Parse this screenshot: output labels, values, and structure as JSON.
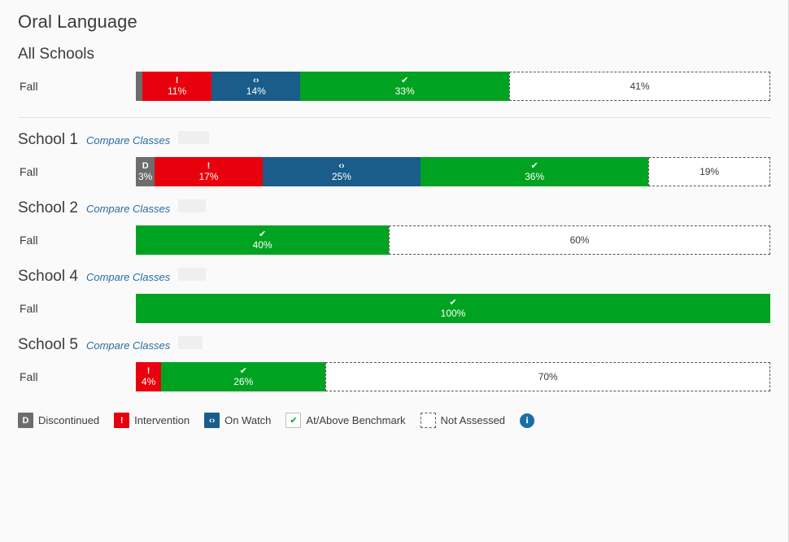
{
  "header": {
    "title": "Oral Language"
  },
  "compare_label": "Compare Classes",
  "row_label": "Fall",
  "legend": {
    "items": [
      {
        "key": "discontinued",
        "glyph": "D",
        "label": "Discontinued",
        "color": "#6d6d6d"
      },
      {
        "key": "intervention",
        "glyph": "!",
        "label": "Intervention",
        "color": "#e8000d"
      },
      {
        "key": "onwatch",
        "glyph": "‹›",
        "label": "On Watch",
        "color": "#1a5c8a"
      },
      {
        "key": "benchmark",
        "glyph": "✔",
        "label": "At/Above Benchmark",
        "color": "#00a321"
      },
      {
        "key": "notassessed",
        "glyph": "",
        "label": "Not Assessed",
        "color": "#ffffff"
      }
    ],
    "info_icon": "info-icon"
  },
  "chart_data": {
    "type": "bar",
    "title": "Oral Language",
    "orientation": "horizontal",
    "stacked": true,
    "unit": "percent",
    "xlim": [
      0,
      100
    ],
    "grid": false,
    "legend_position": "bottom",
    "series": [
      {
        "name": "Discontinued",
        "color": "#6d6d6d"
      },
      {
        "name": "Intervention",
        "color": "#e8000d"
      },
      {
        "name": "On Watch",
        "color": "#1a5c8a"
      },
      {
        "name": "At/Above Benchmark",
        "color": "#00a321"
      },
      {
        "name": "Not Assessed",
        "color": "#ffffff"
      }
    ],
    "groups": [
      {
        "name": "All Schools",
        "has_compare": false,
        "rows": [
          {
            "label": "Fall",
            "segments": [
              {
                "key": "discontinued",
                "value": 1,
                "display": "",
                "glyph": ""
              },
              {
                "key": "intervention",
                "value": 11,
                "display": "11%",
                "glyph": "!"
              },
              {
                "key": "onwatch",
                "value": 14,
                "display": "14%",
                "glyph": "‹›"
              },
              {
                "key": "benchmark",
                "value": 33,
                "display": "33%",
                "glyph": "✔"
              },
              {
                "key": "notassessed",
                "value": 41,
                "display": "41%",
                "glyph": ""
              }
            ]
          }
        ]
      },
      {
        "name": "School 1",
        "has_compare": true,
        "rows": [
          {
            "label": "Fall",
            "segments": [
              {
                "key": "discontinued",
                "value": 3,
                "display": "3%",
                "glyph": "D"
              },
              {
                "key": "intervention",
                "value": 17,
                "display": "17%",
                "glyph": "!"
              },
              {
                "key": "onwatch",
                "value": 25,
                "display": "25%",
                "glyph": "‹›"
              },
              {
                "key": "benchmark",
                "value": 36,
                "display": "36%",
                "glyph": "✔"
              },
              {
                "key": "notassessed",
                "value": 19,
                "display": "19%",
                "glyph": ""
              }
            ]
          }
        ]
      },
      {
        "name": "School 2",
        "has_compare": true,
        "rows": [
          {
            "label": "Fall",
            "segments": [
              {
                "key": "benchmark",
                "value": 40,
                "display": "40%",
                "glyph": "✔"
              },
              {
                "key": "notassessed",
                "value": 60,
                "display": "60%",
                "glyph": ""
              }
            ]
          }
        ]
      },
      {
        "name": "School 4",
        "has_compare": true,
        "rows": [
          {
            "label": "Fall",
            "segments": [
              {
                "key": "benchmark",
                "value": 100,
                "display": "100%",
                "glyph": "✔"
              }
            ]
          }
        ]
      },
      {
        "name": "School 5",
        "has_compare": true,
        "rows": [
          {
            "label": "Fall",
            "segments": [
              {
                "key": "intervention",
                "value": 4,
                "display": "4%",
                "glyph": "!"
              },
              {
                "key": "benchmark",
                "value": 26,
                "display": "26%",
                "glyph": "✔"
              },
              {
                "key": "notassessed",
                "value": 70,
                "display": "70%",
                "glyph": ""
              }
            ]
          }
        ]
      }
    ]
  }
}
